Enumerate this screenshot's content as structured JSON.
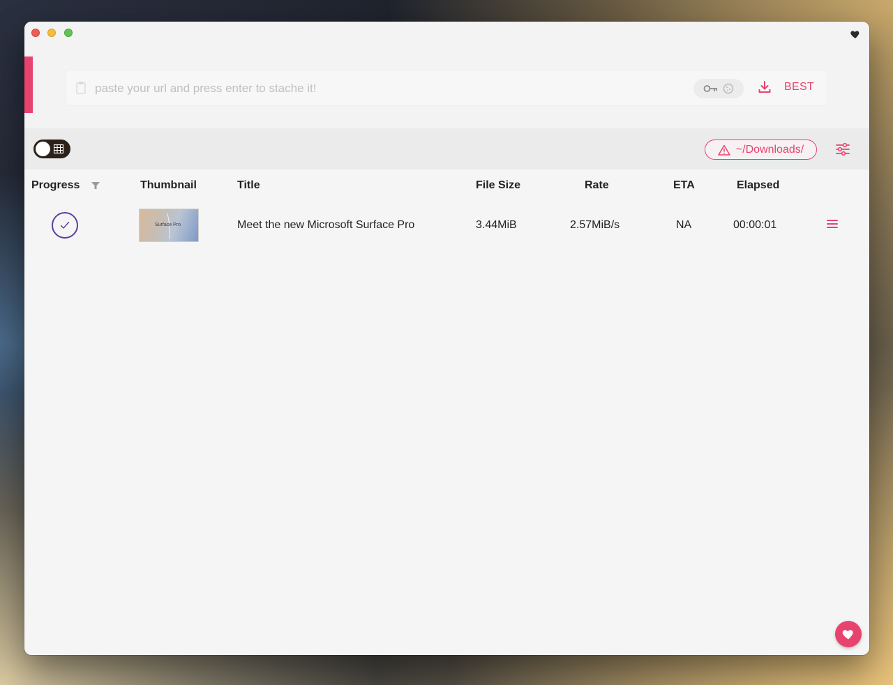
{
  "url_bar": {
    "placeholder": "paste your url and press enter to stache it!",
    "quality_label": "BEST"
  },
  "toolbar": {
    "download_dir": "~/Downloads/"
  },
  "table": {
    "headers": {
      "progress": "Progress",
      "thumbnail": "Thumbnail",
      "title": "Title",
      "file_size": "File Size",
      "rate": "Rate",
      "eta": "ETA",
      "elapsed": "Elapsed"
    },
    "rows": [
      {
        "status": "complete",
        "thumbnail_text": "Surface Pro",
        "title": "Meet the new Microsoft Surface Pro",
        "file_size": "3.44MiB",
        "rate": "2.57MiB/s",
        "eta": "NA",
        "elapsed": "00:00:01"
      }
    ]
  },
  "colors": {
    "accent": "#e8436f",
    "progress_done": "#5b3e9e",
    "toggle_dark": "#2b2117"
  },
  "icons": [
    "clipboard-icon",
    "key-icon",
    "cookie-icon",
    "download-icon",
    "warning-icon",
    "sliders-icon",
    "filter-icon",
    "checkmark-icon",
    "menu-icon",
    "heart-icon",
    "grid-icon"
  ]
}
